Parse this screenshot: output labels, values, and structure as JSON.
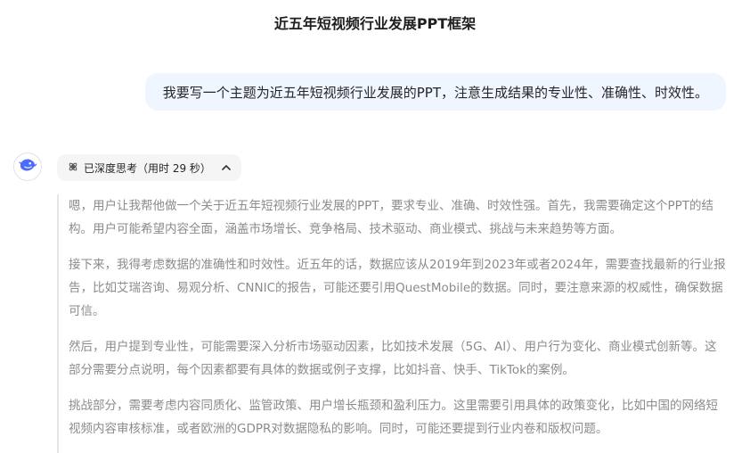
{
  "header": {
    "title": "近五年短视频行业发展PPT框架"
  },
  "user_message": {
    "text": "我要写一个主题为近五年短视频行业发展的PPT，注意生成结果的专业性、准确性、时效性。"
  },
  "assistant": {
    "avatar_icon": "whale-logo-icon",
    "brand_color": "#4d6bfe",
    "think_toggle": {
      "icon": "deep-think-icon",
      "label": "已深度思考（用时 29 秒）",
      "chevron": "chevron-up-icon"
    },
    "thinking_paragraphs": [
      "嗯，用户让我帮他做一个关于近五年短视频行业发展的PPT，要求专业、准确、时效性强。首先，我需要确定这个PPT的结构。用户可能希望内容全面，涵盖市场增长、竞争格局、技术驱动、商业模式、挑战与未来趋势等方面。",
      "接下来，我得考虑数据的准确性和时效性。近五年的话，数据应该从2019年到2023年或者2024年，需要查找最新的行业报告，比如艾瑞咨询、易观分析、CNNIC的报告，可能还要引用QuestMobile的数据。同时，要注意来源的权威性，确保数据可信。",
      "然后，用户提到专业性，可能需要深入分析市场驱动因素，比如技术发展（5G、AI）、用户行为变化、商业模式创新等。这部分需要分点说明，每个因素都要有具体的数据或例子支撑，比如抖音、快手、TikTok的案例。",
      "挑战部分，需要考虑内容同质化、监管政策、用户增长瓶颈和盈利压力。这里需要引用具体的政策变化，比如中国的网络短视频内容审核标准，或者欧洲的GDPR对数据隐私的影响。同时，可能还要提到行业内卷和版权问题。"
    ]
  }
}
